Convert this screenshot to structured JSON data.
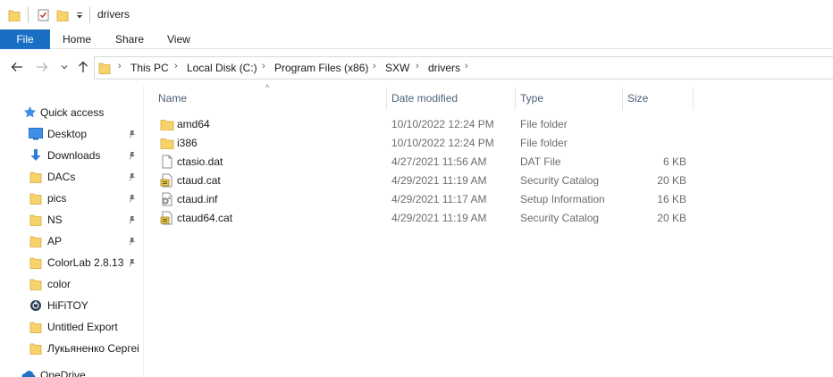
{
  "window": {
    "title": "drivers",
    "quick_access_icons": [
      "folder-icon",
      "properties-check-icon",
      "new-folder-icon",
      "customize-dropdown-icon"
    ]
  },
  "ribbon": {
    "tabs": [
      "File",
      "Home",
      "Share",
      "View"
    ],
    "active_color": "#1a6fc4"
  },
  "navigation": {
    "back": "back-arrow-icon",
    "forward": "forward-arrow-icon",
    "recent": "recent-locations-chevron-icon",
    "up": "up-arrow-icon"
  },
  "address": {
    "crumbs": [
      "This PC",
      "Local Disk (C:)",
      "Program Files (x86)",
      "SXW",
      "drivers"
    ]
  },
  "sidebar": {
    "quick_access_label": "Quick access",
    "items": [
      {
        "label": "Desktop",
        "icon": "desktop-icon",
        "pinned": true
      },
      {
        "label": "Downloads",
        "icon": "download-arrow-icon",
        "pinned": true
      },
      {
        "label": "DACs",
        "icon": "folder-icon",
        "pinned": true
      },
      {
        "label": "pics",
        "icon": "folder-icon",
        "pinned": true
      },
      {
        "label": "NS",
        "icon": "folder-icon",
        "pinned": true
      },
      {
        "label": "AP",
        "icon": "folder-icon",
        "pinned": true
      },
      {
        "label": "ColorLab 2.8.13",
        "icon": "folder-icon",
        "pinned": true
      },
      {
        "label": "color",
        "icon": "folder-icon",
        "pinned": false
      },
      {
        "label": "HiFiTOY",
        "icon": "app-icon",
        "pinned": false
      },
      {
        "label": "Untitled Export",
        "icon": "folder-icon",
        "pinned": false
      },
      {
        "label": "Лукьяненко Сергеі",
        "icon": "folder-icon",
        "pinned": false
      }
    ],
    "next_section_label": "OneDrive"
  },
  "columns": {
    "name": "Name",
    "date": "Date modified",
    "type": "Type",
    "size": "Size"
  },
  "files": [
    {
      "name": "amd64",
      "date": "10/10/2022 12:24 PM",
      "type": "File folder",
      "size": "",
      "icon": "folder-icon"
    },
    {
      "name": "i386",
      "date": "10/10/2022 12:24 PM",
      "type": "File folder",
      "size": "",
      "icon": "folder-icon"
    },
    {
      "name": "ctasio.dat",
      "date": "4/27/2021 11:56 AM",
      "type": "DAT File",
      "size": "6 KB",
      "icon": "file-icon"
    },
    {
      "name": "ctaud.cat",
      "date": "4/29/2021 11:19 AM",
      "type": "Security Catalog",
      "size": "20 KB",
      "icon": "security-catalog-icon"
    },
    {
      "name": "ctaud.inf",
      "date": "4/29/2021 11:17 AM",
      "type": "Setup Information",
      "size": "16 KB",
      "icon": "setup-info-icon"
    },
    {
      "name": "ctaud64.cat",
      "date": "4/29/2021 11:19 AM",
      "type": "Security Catalog",
      "size": "20 KB",
      "icon": "security-catalog-icon"
    }
  ]
}
